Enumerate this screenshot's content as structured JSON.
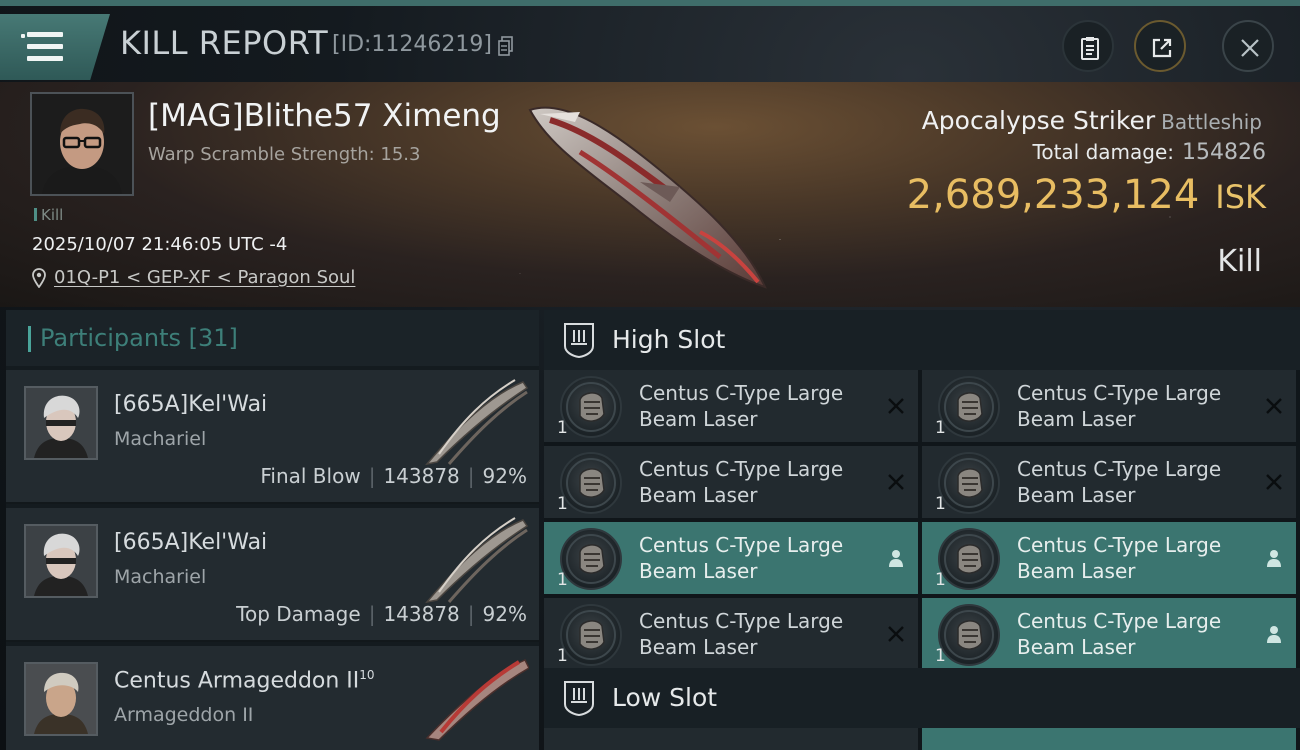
{
  "header": {
    "title": "KILL REPORT",
    "report_id": "[ID:11246219]",
    "icons": [
      "menu-icon",
      "copy-icon",
      "clipboard-icon",
      "share-icon",
      "close-icon"
    ]
  },
  "victim": {
    "name": "[MAG]Blithe57 Ximeng",
    "warp_scramble": "Warp Scramble Strength: 15.3",
    "tag": "Kill",
    "datetime": "2025/10/07 21:46:05 UTC -4",
    "location": "01Q-P1 < GEP-XF < Paragon Soul",
    "ship": "Apocalypse Striker",
    "ship_class": "Battleship",
    "total_damage_label": "Total damage:",
    "total_damage": "154826",
    "isk_value": "2,689,233,124",
    "isk_unit": "ISK",
    "result": "Kill"
  },
  "participants": {
    "label": "Participants",
    "count": "[31]",
    "items": [
      {
        "name": "[665A]Kel'Wai",
        "ship": "Machariel",
        "role": "Final Blow",
        "damage": "143878",
        "percent": "92%"
      },
      {
        "name": "[665A]Kel'Wai",
        "ship": "Machariel",
        "role": "Top Damage",
        "damage": "143878",
        "percent": "92%"
      },
      {
        "name": "Centus Armageddon II",
        "name_sup": "10",
        "ship": "Armageddon II"
      }
    ]
  },
  "fitting": {
    "high_slot_label": "High Slot",
    "low_slot_label": "Low Slot",
    "high_slots": [
      {
        "name": "Centus C-Type Large Beam Laser",
        "qty": "1",
        "status": "destroyed"
      },
      {
        "name": "Centus C-Type Large Beam Laser",
        "qty": "1",
        "status": "destroyed"
      },
      {
        "name": "Centus C-Type Large Beam Laser",
        "qty": "1",
        "status": "destroyed"
      },
      {
        "name": "Centus C-Type Large Beam Laser",
        "qty": "1",
        "status": "destroyed"
      },
      {
        "name": "Centus C-Type Large Beam Laser",
        "qty": "1",
        "status": "dropped"
      },
      {
        "name": "Centus C-Type Large Beam Laser",
        "qty": "1",
        "status": "dropped"
      },
      {
        "name": "Centus C-Type Large Beam Laser",
        "qty": "1",
        "status": "destroyed"
      },
      {
        "name": "Centus C-Type Large Beam Laser",
        "qty": "1",
        "status": "dropped"
      }
    ]
  },
  "colors": {
    "accent_teal": "#3b7570",
    "isk_gold": "#e8bd62"
  }
}
